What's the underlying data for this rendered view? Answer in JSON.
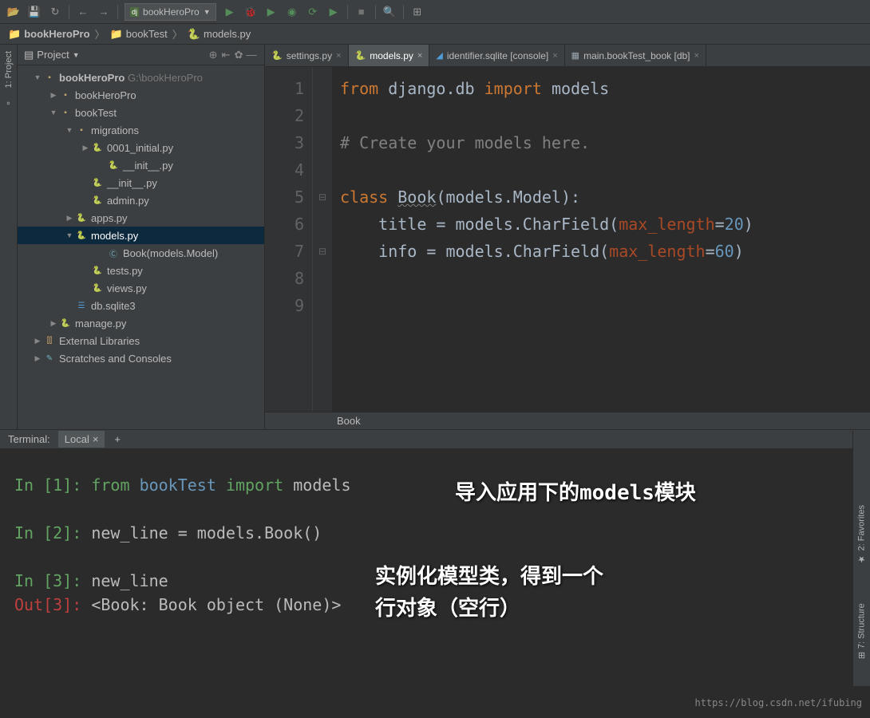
{
  "toolbar": {
    "runConfig": "bookHeroPro"
  },
  "breadcrumb": {
    "project": "bookHeroPro",
    "folder": "bookTest",
    "file": "models.py"
  },
  "projectPanel": {
    "title": "Project"
  },
  "tree": {
    "root": "bookHeroPro",
    "rootPath": "G:\\bookHeroPro",
    "items": [
      {
        "label": "bookHeroPro",
        "indent": 40,
        "arrow": "collapsed",
        "icon": "folder"
      },
      {
        "label": "bookTest",
        "indent": 40,
        "arrow": "expanded",
        "icon": "folder"
      },
      {
        "label": "migrations",
        "indent": 60,
        "arrow": "expanded",
        "icon": "folder"
      },
      {
        "label": "0001_initial.py",
        "indent": 80,
        "arrow": "collapsed",
        "icon": "py"
      },
      {
        "label": "__init__.py",
        "indent": 100,
        "arrow": "",
        "icon": "py"
      },
      {
        "label": "__init__.py",
        "indent": 80,
        "arrow": "",
        "icon": "py"
      },
      {
        "label": "admin.py",
        "indent": 80,
        "arrow": "",
        "icon": "py"
      },
      {
        "label": "apps.py",
        "indent": 60,
        "arrow": "collapsed",
        "icon": "py"
      },
      {
        "label": "models.py",
        "indent": 60,
        "arrow": "expanded",
        "icon": "py",
        "sel": true
      },
      {
        "label": "Book(models.Model)",
        "indent": 100,
        "arrow": "",
        "icon": "class"
      },
      {
        "label": "tests.py",
        "indent": 80,
        "arrow": "",
        "icon": "py"
      },
      {
        "label": "views.py",
        "indent": 80,
        "arrow": "",
        "icon": "py"
      },
      {
        "label": "db.sqlite3",
        "indent": 60,
        "arrow": "",
        "icon": "db"
      },
      {
        "label": "manage.py",
        "indent": 40,
        "arrow": "collapsed",
        "icon": "py"
      },
      {
        "label": "External Libraries",
        "indent": 20,
        "arrow": "collapsed",
        "icon": "lib"
      },
      {
        "label": "Scratches and Consoles",
        "indent": 20,
        "arrow": "collapsed",
        "icon": "scratch"
      }
    ]
  },
  "tabs": [
    {
      "label": "settings.py",
      "icon": "py"
    },
    {
      "label": "models.py",
      "icon": "py",
      "active": true
    },
    {
      "label": "identifier.sqlite [console]",
      "icon": "db"
    },
    {
      "label": "main.bookTest_book [db]",
      "icon": "table"
    }
  ],
  "code": {
    "lines": [
      "1",
      "2",
      "3",
      "4",
      "5",
      "6",
      "7",
      "8",
      "9"
    ],
    "l1_from": "from",
    "l1_m1": "django.db",
    "l1_import": "import",
    "l1_m2": "models",
    "l3_comment": "# Create your models here.",
    "l5_class": "class",
    "l5_name": "Book",
    "l5_paren": "(models.Model):",
    "l6_lhs": "    title = models.CharField(",
    "l6_param": "max_length",
    "l6_eq": "=",
    "l6_val": "20",
    "l6_close": ")",
    "l7_lhs": "    info = models.CharField(",
    "l7_param": "max_length",
    "l7_eq": "=",
    "l7_val": "60",
    "l7_close": ")"
  },
  "editorFooter": "Book",
  "terminal": {
    "tabLabel": "Terminal:",
    "localTab": "Local",
    "in1_prompt": "In [1]:",
    "in1_code_from": "from",
    "in1_code_mod": "bookTest",
    "in1_code_import": "import",
    "in1_code_models": "models",
    "in2_prompt": "In [2]:",
    "in2_code": "new_line = models.Book()",
    "in3_prompt": "In [3]:",
    "in3_code": "new_line",
    "out3_prompt": "Out[3]:",
    "out3_val": "<Book: Book object (None)>"
  },
  "annotations": {
    "a1": "导入应用下的models模块",
    "a2_l1": "实例化模型类，得到一个",
    "a2_l2": "行对象（空行）"
  },
  "sideLabels": {
    "project": "1: Project",
    "favorites": "2: Favorites",
    "structure": "7: Structure"
  },
  "watermark": "https://blog.csdn.net/ifubing"
}
